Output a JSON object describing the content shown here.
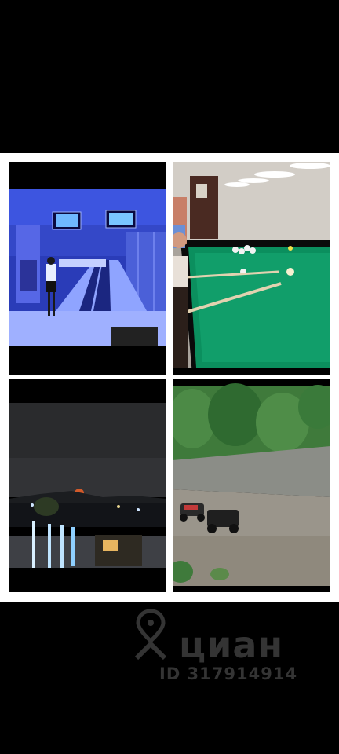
{
  "collage": {
    "photos": [
      {
        "subject": "bowling-alley"
      },
      {
        "subject": "billiards-table"
      },
      {
        "subject": "night-sea-view"
      },
      {
        "subject": "river-with-rc-cars"
      }
    ]
  },
  "watermark": {
    "brand": "циан",
    "listing_id": "ID 317914914",
    "icon": "map-pin-icon",
    "color": "#3a3a3a"
  }
}
